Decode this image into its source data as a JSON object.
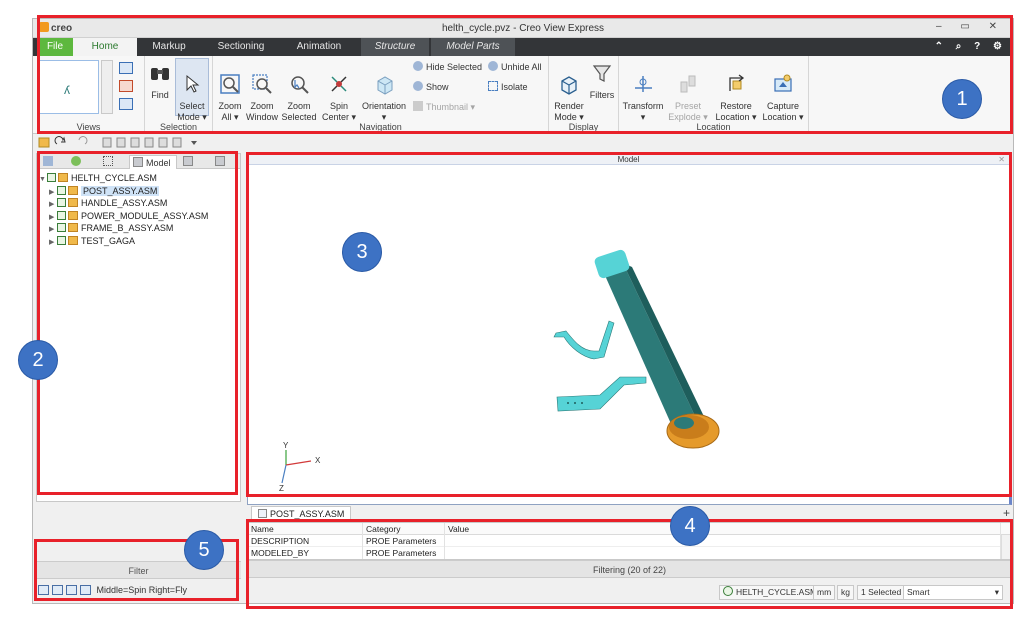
{
  "app": {
    "logo_text": "creo",
    "title": "helth_cycle.pvz - Creo View Express",
    "window_controls": "– ▭ ✕",
    "help_icons": "⌃ ⌕ ? ⚙"
  },
  "tabs": [
    {
      "label": "File"
    },
    {
      "label": "Home"
    },
    {
      "label": "Markup"
    },
    {
      "label": "Sectioning"
    },
    {
      "label": "Animation"
    },
    {
      "label": "Structure"
    },
    {
      "label": "Model Parts"
    }
  ],
  "ribbon": {
    "views": {
      "label": "Views"
    },
    "selection": {
      "label": "Selection",
      "find": "Find",
      "select_mode": "Select\nMode ▾"
    },
    "navigation": {
      "label": "Navigation",
      "zoom_all": "Zoom\nAll ▾",
      "zoom_window": "Zoom\nWindow",
      "zoom_selected": "Zoom\nSelected",
      "spin_center": "Spin\nCenter ▾",
      "orientation": "Orientation\n▾",
      "hide_selected": "Hide Selected",
      "unhide_all": "Unhide All",
      "show": "Show",
      "isolate": "Isolate",
      "thumbnail": "Thumbnail ▾"
    },
    "display": {
      "label": "Display",
      "render_mode": "Render\nMode ▾",
      "filters": "Filters"
    },
    "location": {
      "label": "Location",
      "transform": "Transform\n▾",
      "preset_explode": "Preset\nExplode ▾",
      "restore_location": "Restore\nLocation ▾",
      "capture_location": "Capture\nLocation ▾"
    }
  },
  "left_panel": {
    "tabs": [
      {
        "label": ""
      },
      {
        "label": ""
      },
      {
        "label": ""
      },
      {
        "label": "Model"
      },
      {
        "label": ""
      },
      {
        "label": ""
      }
    ],
    "tree": {
      "root": "HELTH_CYCLE.ASM",
      "children": [
        "POST_ASSY.ASM",
        "HANDLE_ASSY.ASM",
        "POWER_MODULE_ASSY.ASM",
        "FRAME_B_ASSY.ASM",
        "TEST_GAGA"
      ]
    },
    "filter_label": "Filter",
    "mouse_hint": "Middle=Spin   Right=Fly"
  },
  "viewport": {
    "title": "Model",
    "axes": {
      "x": "X",
      "y": "Y",
      "z": "Z"
    }
  },
  "info_panel": {
    "tab_label": "POST_ASSY.ASM",
    "add_icon": "+",
    "columns": [
      "Name",
      "Category",
      "Value"
    ],
    "rows": [
      [
        "DESCRIPTION",
        "PROE Parameters",
        ""
      ],
      [
        "MODELED_BY",
        "PROE Parameters",
        ""
      ]
    ],
    "filter_status": "Filtering (20 of 22)"
  },
  "status_bar": {
    "model": "HELTH_CYCLE.ASM",
    "length_unit": "mm",
    "mass_unit": "kg",
    "selected": "1 Selected",
    "selection_filter": "Smart"
  },
  "annotations": [
    {
      "number": "1"
    },
    {
      "number": "2"
    },
    {
      "number": "3"
    },
    {
      "number": "4"
    },
    {
      "number": "5"
    }
  ],
  "colors": {
    "highlight": "#e8212a",
    "badge": "#3d72c4",
    "file_tab": "#5db83e",
    "tab_bar": "#333538",
    "model_teal": "#2c7a78",
    "model_cyan": "#56d3d6",
    "model_orange": "#e59a2b"
  }
}
